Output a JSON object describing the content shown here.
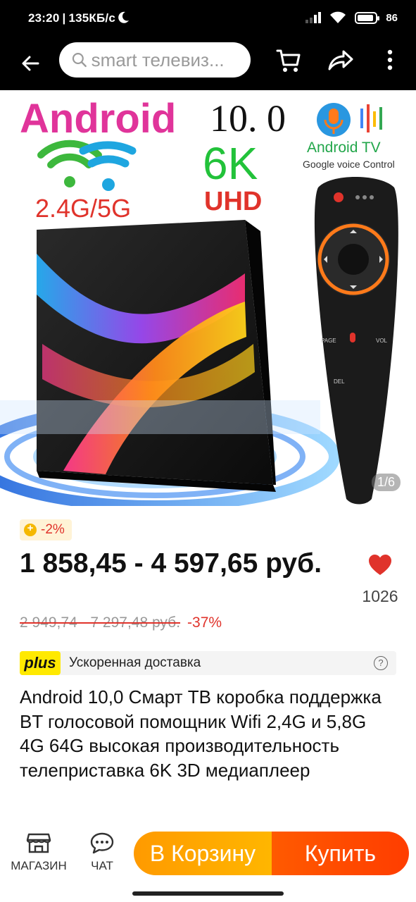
{
  "status_bar": {
    "time": "23:20",
    "speed": "135КБ/с",
    "battery": "86",
    "icons": [
      "moon-icon",
      "signal-icon",
      "wifi-icon",
      "battery-icon"
    ]
  },
  "top_bar": {
    "search_placeholder": "smart телевиз...",
    "icons": [
      "back-arrow-icon",
      "search-icon",
      "cart-icon",
      "share-icon",
      "more-vertical-icon"
    ]
  },
  "hero": {
    "brand": "Android",
    "version": "10. 0",
    "resolution": "6K",
    "resolution_sub": "UHD",
    "wifi_bands": "2.4G/5G",
    "badge_title": "Android TV",
    "badge_sub": "Google voice Control",
    "remote_labels": [
      "PAGE",
      "VOL",
      "DEL"
    ],
    "counter": "1/6"
  },
  "price": {
    "coupon": "-2%",
    "current": "1 858,45 - 4 597,65 руб.",
    "original": "2 949,74 - 7 297,48 руб.",
    "discount": "-37%"
  },
  "wishlist": {
    "count": "1026"
  },
  "delivery": {
    "badge": "plus",
    "text": "Ускоренная доставка"
  },
  "product": {
    "title": "Android 10,0 Смарт ТВ коробка поддержка BT голосовой помощник Wifi 2,4G и 5,8G 4G 64G высокая производительность телеприставка 6K 3D медиаплеер"
  },
  "bottom_bar": {
    "store_label": "МАГАЗИН",
    "chat_label": "ЧАТ",
    "cart_button": "В Корзину",
    "buy_button": "Купить"
  },
  "colors": {
    "accent_red": "#e0332b",
    "cart_orange": "#ffa500",
    "buy_orange": "#ff4a00",
    "plus_yellow": "#ffe900"
  }
}
